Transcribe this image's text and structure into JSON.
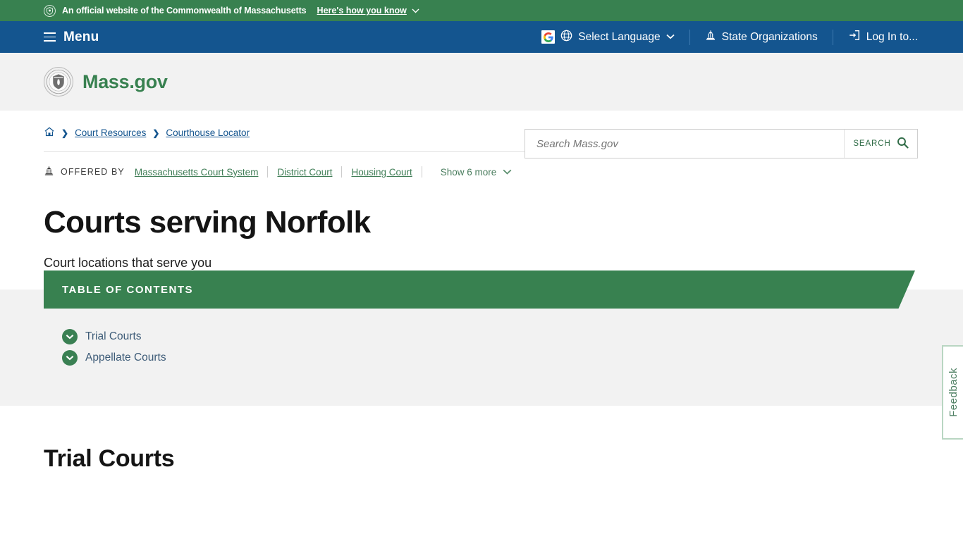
{
  "official_banner": {
    "text": "An official website of the Commonwealth of Massachusetts",
    "how_you_know": "Here's how you know",
    "seal_icon": "state-seal-icon",
    "chevron_icon": "chevron-down-icon",
    "background_color": "#388150"
  },
  "nav": {
    "menu_label": "Menu",
    "menu_icon": "hamburger-icon",
    "background_color": "#14558f",
    "items": [
      {
        "label": "Select Language",
        "icon": "globe-icon",
        "extra_icon": "google-logo-icon",
        "chevron": "chevron-down-icon"
      },
      {
        "label": "State Organizations",
        "icon": "capitol-building-icon"
      },
      {
        "label": "Log In to...",
        "icon": "login-arrow-icon"
      }
    ]
  },
  "masthead": {
    "brand_name": "Mass.gov",
    "brand_icon": "mass-state-seal-icon",
    "brand_color": "#388150",
    "search": {
      "placeholder": "Search Mass.gov",
      "value": "",
      "button_label": "SEARCH",
      "button_icon": "magnifier-icon"
    }
  },
  "breadcrumb": {
    "home_icon": "home-icon",
    "separator_icon": "chevron-right-icon",
    "items": [
      {
        "label": "Court Resources"
      },
      {
        "label": "Courthouse Locator"
      }
    ]
  },
  "offered_by": {
    "icon": "capitol-building-icon",
    "label": "OFFERED BY",
    "organizations": [
      "Massachusetts Court System",
      "District Court",
      "Housing Court"
    ],
    "show_more_label": "Show 6 more",
    "show_more_icon": "chevron-down-icon"
  },
  "page": {
    "title": "Courts serving Norfolk",
    "subtitle": "Court locations that serve you"
  },
  "table_of_contents": {
    "banner_label": "TABLE OF CONTENTS",
    "banner_color": "#388150",
    "items": [
      {
        "label": "Trial Courts",
        "icon": "chevron-down-circle-icon"
      },
      {
        "label": "Appellate Courts",
        "icon": "chevron-down-circle-icon"
      }
    ]
  },
  "main_section": {
    "heading": "Trial Courts"
  },
  "feedback": {
    "label": "Feedback"
  }
}
